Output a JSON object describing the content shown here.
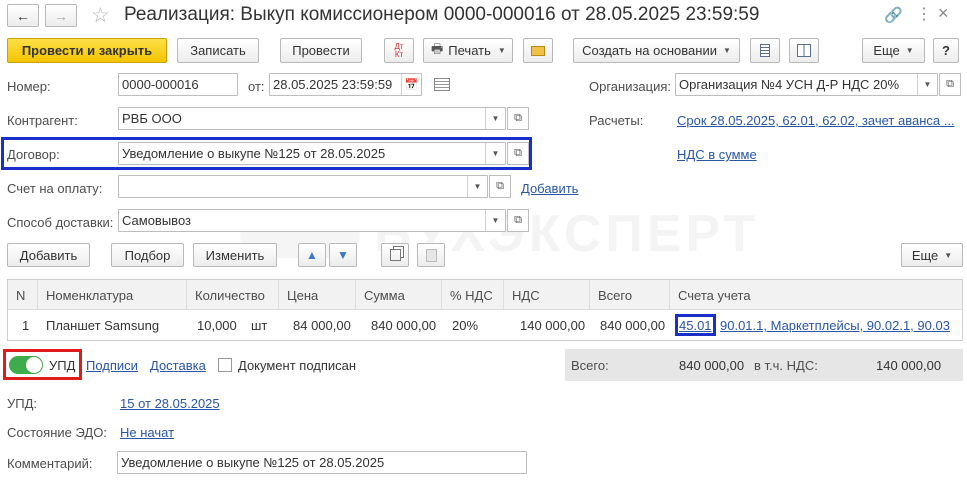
{
  "window": {
    "title": "Реализация: Выкуп комиссионером 0000-000016 от 28.05.2025 23:59:59"
  },
  "toolbar": {
    "post_close": "Провести и закрыть",
    "save": "Записать",
    "post": "Провести",
    "dtkt_top": "Дт",
    "dtkt_bottom": "Кт",
    "print": "Печать",
    "create_based": "Создать на основании",
    "more": "Еще",
    "help": "?"
  },
  "form": {
    "number_label": "Номер:",
    "number_value": "0000-000016",
    "date_label": "от:",
    "date_value": "28.05.2025 23:59:59",
    "org_label": "Организация:",
    "org_value": "Организация №4 УСН Д-Р НДС 20%",
    "contractor_label": "Контрагент:",
    "contractor_value": "РВБ ООО",
    "settlements_label": "Расчеты:",
    "settlements_link": "Срок 28.05.2025, 62.01, 62.02, зачет аванса ...",
    "contract_label": "Договор:",
    "contract_value": "Уведомление о выкупе №125 от 28.05.2025",
    "vat_link": "НДС в сумме",
    "invoice_label": "Счет на оплату:",
    "invoice_value": "",
    "invoice_add": "Добавить",
    "delivery_label": "Способ доставки:",
    "delivery_value": "Самовывоз"
  },
  "watermark": "БУХЭКСПЕРТ",
  "table_toolbar": {
    "add": "Добавить",
    "select": "Подбор",
    "change": "Изменить",
    "more": "Еще"
  },
  "table": {
    "headers": [
      "N",
      "Номенклатура",
      "Количество",
      "Цена",
      "Сумма",
      "% НДС",
      "НДС",
      "Всего",
      "Счета учета"
    ],
    "row": {
      "n": "1",
      "item": "Планшет Samsung",
      "qty": "10,000",
      "unit": "шт",
      "price": "84 000,00",
      "sum": "840 000,00",
      "vat_rate": "20%",
      "vat": "140 000,00",
      "total": "840 000,00",
      "account_main": "45.01",
      "account_rest": "90.01.1, Маркетплейсы, 90.02.1, 90.03"
    }
  },
  "footer": {
    "upd_toggle": "УПД",
    "signatures": "Подписи",
    "delivery": "Доставка",
    "signed_checkbox": "Документ подписан",
    "total_label": "Всего:",
    "total_value": "840 000,00",
    "vat_incl_label": "в т.ч. НДС:",
    "vat_incl_value": "140 000,00",
    "upd_label": "УПД:",
    "upd_link": "15 от 28.05.2025",
    "edo_label": "Состояние ЭДО:",
    "edo_link": "Не начат",
    "comment_label": "Комментарий:",
    "comment_value": "Уведомление о выкупе №125 от 28.05.2025"
  },
  "colors": {
    "highlight_blue": "#1a2fc9",
    "highlight_red": "#e01b1b",
    "toggle_green": "#3eab4d",
    "primary_yellow": "#f5c400",
    "link_blue": "#2a56a6"
  }
}
